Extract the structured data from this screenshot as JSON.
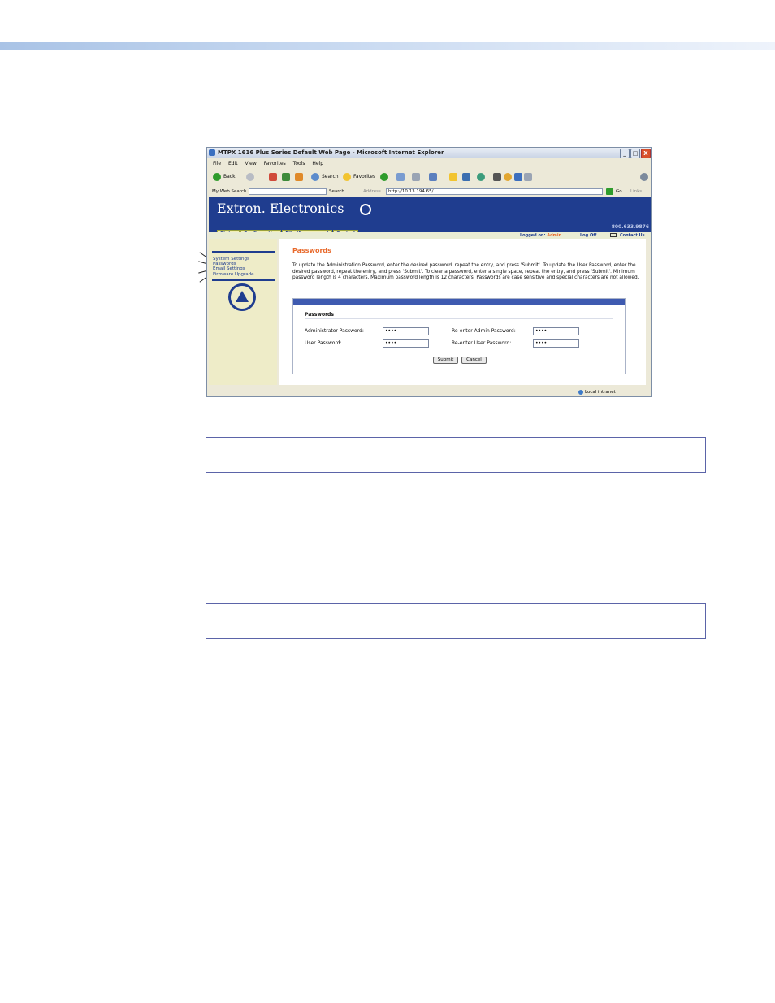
{
  "window": {
    "title": "MTPX 1616 Plus Series Default Web Page - Microsoft Internet Explorer",
    "buttons": {
      "minimize": "_",
      "maximize": "□",
      "close": "X"
    }
  },
  "menu": [
    "File",
    "Edit",
    "View",
    "Favorites",
    "Tools",
    "Help"
  ],
  "toolbar": {
    "back": "Back",
    "search": "Search",
    "favorites": "Favorites"
  },
  "addressbar": {
    "my_web_search": "My Web Search",
    "search_button": "Search",
    "address_label": "Address",
    "url": "http://10.13.194.65/",
    "go": "Go",
    "links": "Links"
  },
  "site": {
    "brand": "Extron. Electronics",
    "tabs": [
      "Status",
      "Configuration",
      "File Management",
      "Control"
    ],
    "phone": "800.633.9876",
    "logged_on_label": "Logged on:",
    "logged_on_user": "Admin",
    "log_off": "Log Off",
    "contact_us": "Contact Us"
  },
  "sidebar": {
    "links": [
      "System Settings",
      "Passwords",
      "Email Settings",
      "Firmware Upgrade"
    ]
  },
  "main": {
    "title": "Passwords",
    "intro": "To update the Administration Password, enter the desired password, repeat the entry, and press 'Submit'.  To update the User Password, enter the desired password, repeat the entry, and press 'Submit'.  To clear a password, enter a single space, repeat the entry, and press 'Submit'.  Minimum password length is 4 characters.  Maximum password length is 12 characters.  Passwords are case sensitive and special characters are not allowed.",
    "form": {
      "section": "Passwords",
      "admin_label": "Administrator Password:",
      "admin_value": "••••",
      "readmin_label": "Re-enter Admin Password:",
      "readmin_value": "••••",
      "user_label": "User Password:",
      "user_value": "••••",
      "reuser_label": "Re-enter User Password:",
      "reuser_value": "••••",
      "submit": "Submit",
      "cancel": "Cancel"
    }
  },
  "statusbar": {
    "zone": "Local intranet"
  },
  "colors": {
    "brand_blue": "#1f3d8f",
    "accent_orange": "#e8692b",
    "sidebar_bg": "#eeecc8"
  }
}
